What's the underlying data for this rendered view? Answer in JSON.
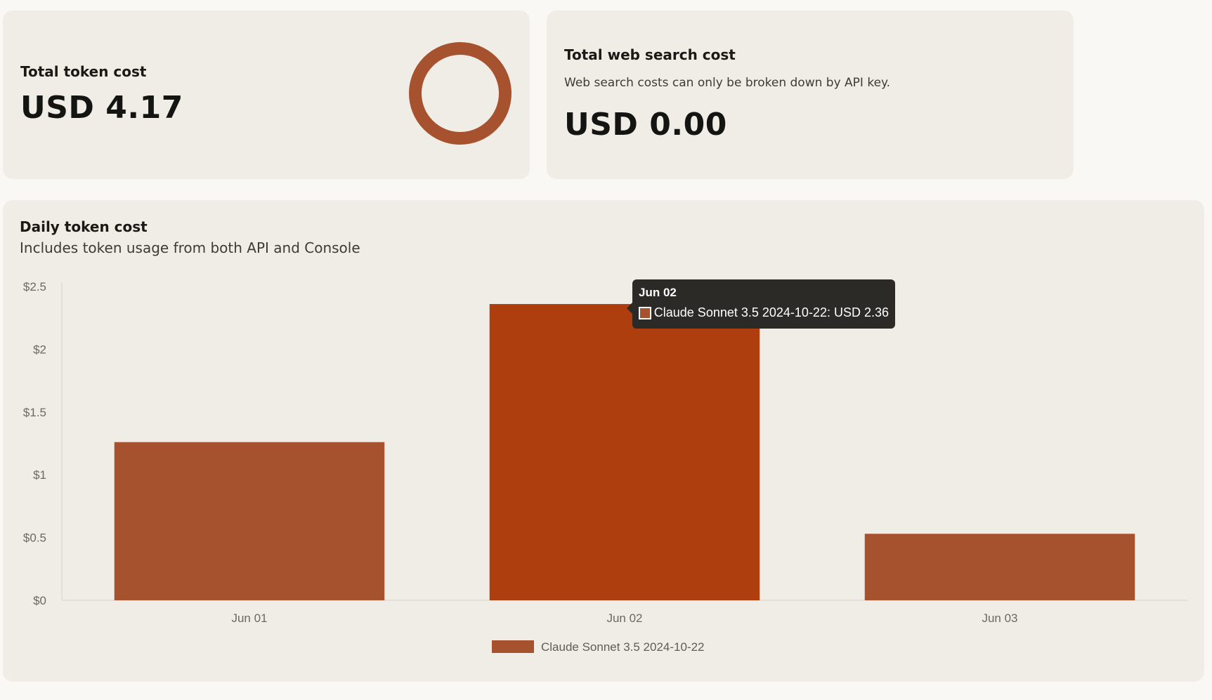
{
  "token_card": {
    "title": "Total token cost",
    "value": "USD 4.17"
  },
  "web_search_card": {
    "title": "Total web search cost",
    "subtitle": "Web search costs can only be broken down by API key.",
    "value": "USD 0.00"
  },
  "daily_card": {
    "title": "Daily token cost",
    "subtitle": "Includes token usage from both API and Console"
  },
  "colors": {
    "bar": "#a6522f",
    "bar_hover": "#ae3e0e",
    "donut": "#a6522f"
  },
  "chart_data": {
    "type": "bar",
    "categories": [
      "Jun 01",
      "Jun 02",
      "Jun 03"
    ],
    "series": [
      {
        "name": "Claude Sonnet 3.5 2024-10-22",
        "values": [
          1.26,
          2.36,
          0.53
        ]
      }
    ],
    "ylim": [
      0,
      2.5
    ],
    "y_ticks": [
      0,
      0.5,
      1,
      1.5,
      2,
      2.5
    ],
    "y_tick_labels": [
      "$0",
      "$0.5",
      "$1",
      "$1.5",
      "$2",
      "$2.5"
    ],
    "legend_placement": "bottom-center",
    "grid": false,
    "highlighted_category": "Jun 02"
  },
  "tooltip": {
    "title": "Jun 02",
    "line": "Claude Sonnet 3.5 2024-10-22: USD 2.36"
  }
}
